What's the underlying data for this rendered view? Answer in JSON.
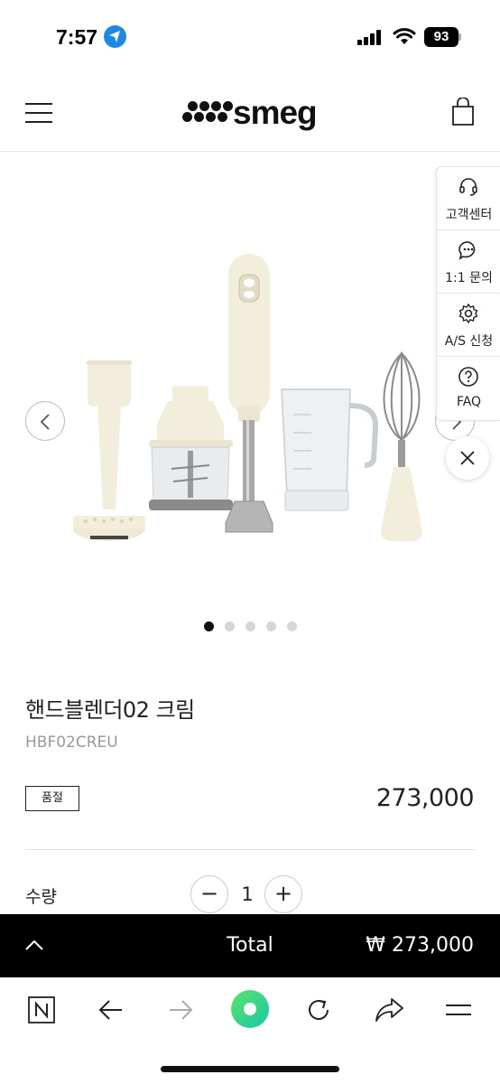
{
  "status_bar": {
    "time": "7:57",
    "battery": "93",
    "icons": [
      "location-arrow-icon",
      "cellular-signal-icon",
      "wifi-icon",
      "battery-icon"
    ]
  },
  "header": {
    "logo_text": "smeg",
    "icons": [
      "hamburger-menu-icon",
      "shopping-bag-icon"
    ]
  },
  "gallery": {
    "slide_count": 5,
    "active_slide": 1,
    "products": [
      "potato-masher-attachment",
      "chopper-attachment",
      "hand-blender",
      "measuring-jug",
      "whisk-attachment"
    ]
  },
  "side_panel": {
    "items": [
      {
        "label": "고객센터",
        "icon": "headset-icon"
      },
      {
        "label": "1:1 문의",
        "icon": "chat-bubble-icon"
      },
      {
        "label": "A/S 신청",
        "icon": "gear-icon"
      },
      {
        "label": "FAQ",
        "icon": "question-icon"
      }
    ],
    "close_icon": "close-icon"
  },
  "product": {
    "name": "핸드블렌더02 크림",
    "code": "HBF02CREU",
    "badge": "품절",
    "price": "273,000"
  },
  "quantity": {
    "label": "수량",
    "value": "1",
    "minus": "−",
    "plus": "+"
  },
  "total_bar": {
    "label": "Total",
    "price": "₩ 273,000"
  },
  "toolbar": {
    "icons": [
      "naver-n-icon",
      "back-arrow-icon",
      "forward-arrow-icon",
      "home-green-icon",
      "reload-icon",
      "share-icon",
      "menu-icon"
    ]
  },
  "colors": {
    "cream": "#f3eedc",
    "black": "#000000",
    "naver_green": "#2fd57a",
    "location_blue": "#1e88e5"
  }
}
